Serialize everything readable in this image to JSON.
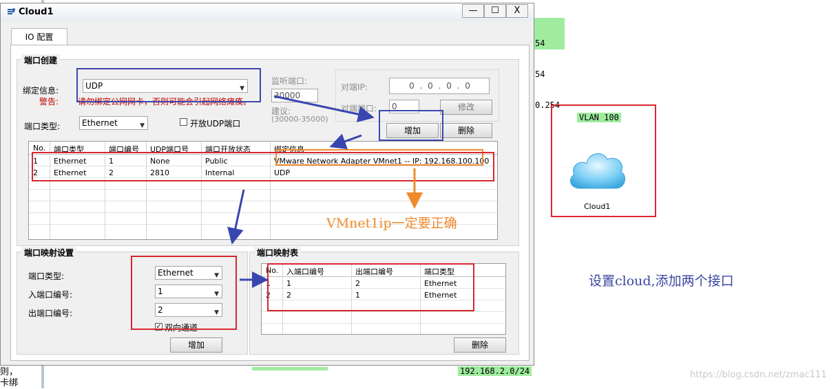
{
  "background": {
    "green_tags": [
      "54",
      "54",
      "0.254"
    ],
    "subnet_label": "192.168.2.0/24",
    "left_text": [
      "则，",
      "卡绑"
    ],
    "vlan_label": "VLAN 100",
    "cloud_label": "Cloud1",
    "annotation_right": "设置cloud,添加两个接口",
    "watermark": "https://blog.csdn.net/zmac111"
  },
  "window": {
    "title": "Cloud1",
    "minimize": "—",
    "maximize": "☐",
    "close": "X",
    "tab_label": "IO 配置"
  },
  "port_create": {
    "group_title": "端口创建",
    "bind_label": "绑定信息:",
    "bind_value": "UDP",
    "warn_label": "警告:",
    "warn_text": "请勿绑定公网网卡，否则可能会引起网络瘫痪。",
    "port_type_label": "端口类型:",
    "port_type_value": "Ethernet",
    "open_udp_label": "开放UDP端口",
    "listen_port_label": "监听端口:",
    "listen_port_value": "30000",
    "suggest_label": "建议:",
    "suggest_range": "(30000-35000)",
    "peer_ip_label": "对端IP:",
    "peer_ip_value": "0 . 0 . 0 . 0",
    "peer_port_label": "对端端口:",
    "peer_port_value": "0",
    "modify_button": "修改",
    "add_button": "增加",
    "delete_button": "删除",
    "table": {
      "headers": [
        "No.",
        "端口类型",
        "端口编号",
        "UDP端口号",
        "端口开放状态",
        "绑定信息"
      ],
      "rows": [
        [
          "1",
          "Ethernet",
          "1",
          "None",
          "Public",
          "VMware Network Adapter VMnet1 -- IP: 192.168.100.100"
        ],
        [
          "2",
          "Ethernet",
          "2",
          "2810",
          "Internal",
          "UDP"
        ]
      ]
    },
    "annotation": "VMnet1ip一定要正确"
  },
  "port_map_settings": {
    "group_title": "端口映射设置",
    "type_label": "端口类型:",
    "type_value": "Ethernet",
    "in_label": "入端口编号:",
    "in_value": "1",
    "out_label": "出端口编号:",
    "out_value": "2",
    "bidirectional_label": "双向通道",
    "bidirectional_checked": true,
    "add_button": "增加"
  },
  "port_map_table": {
    "group_title": "端口映射表",
    "headers": [
      "No.",
      "入端口编号",
      "出端口编号",
      "端口类型"
    ],
    "rows": [
      [
        "1",
        "1",
        "2",
        "Ethernet"
      ],
      [
        "2",
        "2",
        "1",
        "Ethernet"
      ]
    ],
    "delete_button": "删除"
  },
  "colors": {
    "highlight_red": "#d8262e",
    "highlight_blue": "#3a46b0",
    "highlight_orange": "#f08a2c",
    "tag_green": "#9fec9f"
  }
}
